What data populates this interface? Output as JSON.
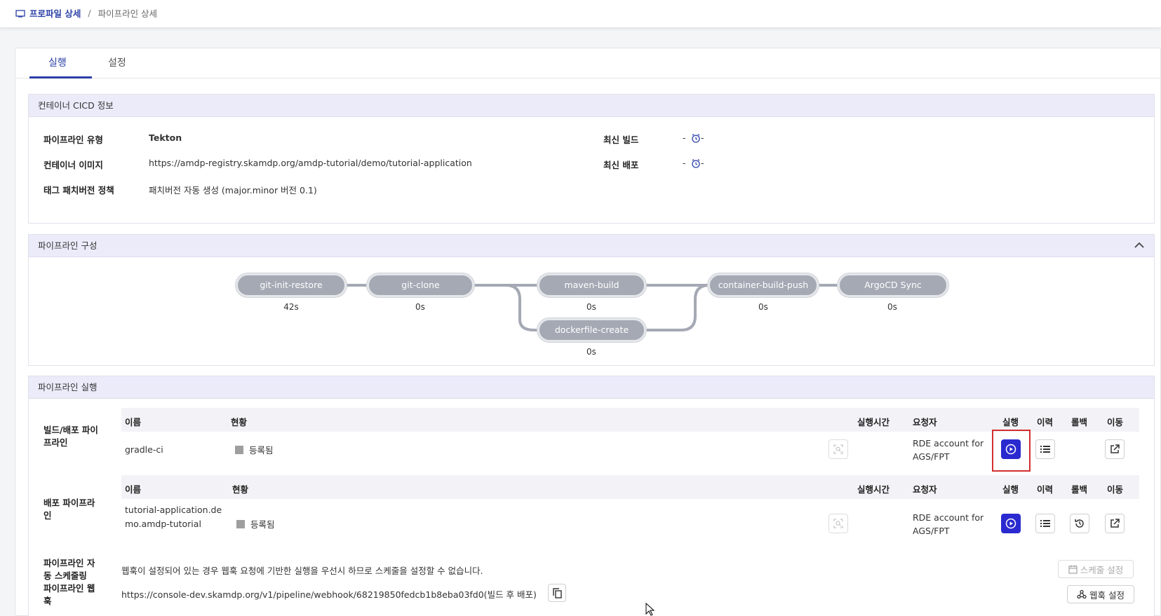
{
  "breadcrumb": {
    "profile": "프로파일 상세",
    "separator": "/",
    "current": "파이프라인 상세"
  },
  "tabs": [
    {
      "label": "실행"
    },
    {
      "label": "설정"
    }
  ],
  "cicd": {
    "title": "컨테이너 CICD 정보",
    "pipeline_type_label": "파이프라인 유형",
    "pipeline_type": "Tekton",
    "image_label": "컨테이너 이미지",
    "image": "https://amdp-registry.skamdp.org/amdp-tutorial/demo/tutorial-application",
    "tag_label": "태그 패치버전 정책",
    "tag": "패치버전 자동 생성 (major.minor 버전 0.1)",
    "latest_build_label": "최신 빌드",
    "latest_build": "-",
    "latest_build_time": "-",
    "latest_deploy_label": "최신 배포",
    "latest_deploy": "-",
    "latest_deploy_time": "-"
  },
  "pipeline": {
    "title": "파이프라인 구성",
    "nodes": [
      {
        "name": "git-init-restore",
        "time": "42s"
      },
      {
        "name": "git-clone",
        "time": "0s"
      },
      {
        "name": "maven-build",
        "time": "0s"
      },
      {
        "name": "dockerfile-create",
        "time": "0s"
      },
      {
        "name": "container-build-push",
        "time": "0s"
      },
      {
        "name": "ArgoCD Sync",
        "time": "0s"
      }
    ]
  },
  "run": {
    "title": "파이프라인 실행",
    "build_label": "빌드/배포 파이프라인",
    "deploy_label": "배포 파이프라인",
    "headers": {
      "name": "이름",
      "status": "현황",
      "duration": "실행시간",
      "requester": "요청자",
      "run": "실행",
      "history": "이력",
      "rollback": "롤백",
      "move": "이동"
    },
    "build_row": {
      "name": "gradle-ci",
      "status": "등록됨",
      "requester": "RDE account for AGS/FPT"
    },
    "deploy_row": {
      "name": "tutorial-application.demo.amdp-tutorial",
      "status": "등록됨",
      "requester": "RDE account for AGS/FPT"
    },
    "schedule_label": "파이프라인 자동 스케줄링",
    "schedule_msg": "웹훅이 설정되어 있는 경우 웹훅 요청에 기반한 실행을 우선시 하므로 스케줄을 설정할 수 없습니다.",
    "schedule_btn": "스케줄 설정",
    "webhook_label": "파이프라인 웹훅",
    "webhook_url": "https://console-dev.skamdp.org/v1/pipeline/webhook/68219850fedcb1b8eba03fd0(빌드 후 배포)",
    "webhook_btn": "웹훅 설정"
  },
  "colors": {
    "accent": "#2b3fa6",
    "run_button": "#2a2ad0",
    "highlight": "#d32f2f",
    "panel_header": "#ecebfa"
  }
}
